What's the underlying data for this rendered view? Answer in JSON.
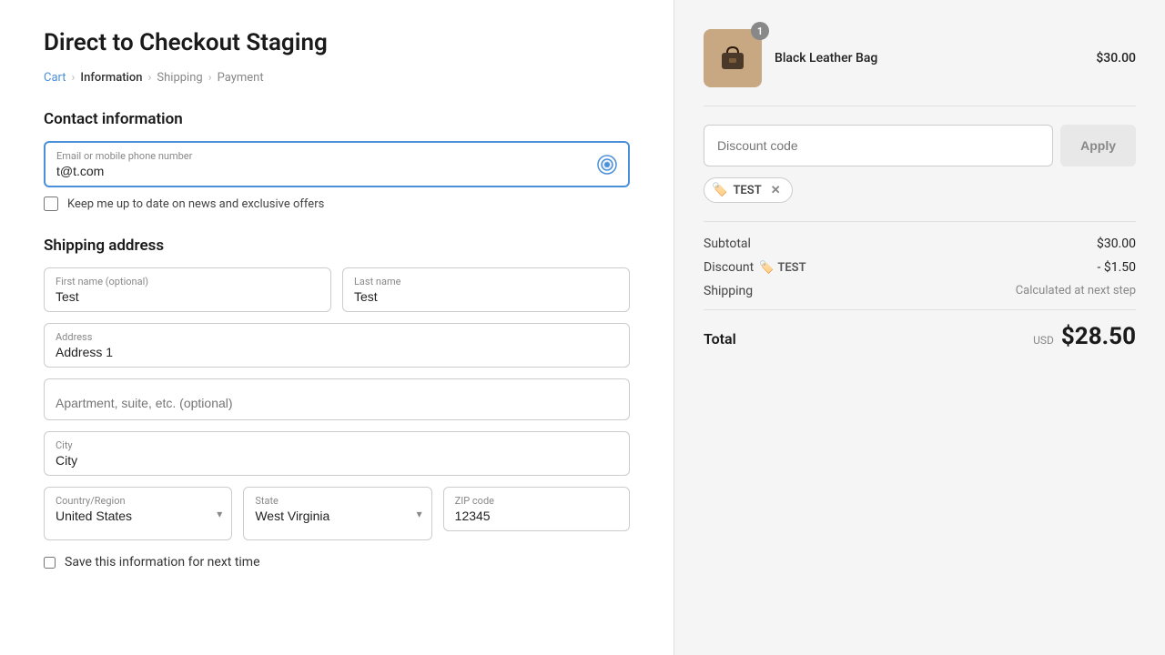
{
  "page": {
    "title": "Direct to Checkout Staging"
  },
  "breadcrumb": {
    "items": [
      "Cart",
      "Information",
      "Shipping",
      "Payment"
    ],
    "active": "Information"
  },
  "contact": {
    "section_title": "Contact information",
    "email_label": "Email or mobile phone number",
    "email_value": "t@t.com",
    "email_placeholder": "",
    "newsletter_label": "Keep me up to date on news and exclusive offers"
  },
  "shipping": {
    "section_title": "Shipping address",
    "first_name_label": "First name (optional)",
    "first_name_value": "Test",
    "last_name_label": "Last name",
    "last_name_value": "Test",
    "address_label": "Address",
    "address_value": "Address 1",
    "apt_label": "Apartment, suite, etc. (optional)",
    "apt_value": "",
    "city_label": "City",
    "city_value": "City",
    "country_label": "Country/Region",
    "country_value": "United States",
    "state_label": "State",
    "state_value": "West Virginia",
    "zip_label": "ZIP code",
    "zip_value": "12345",
    "save_label": "Save this information for next time"
  },
  "order": {
    "product_name": "Black Leather Bag",
    "product_price": "$30.00",
    "product_quantity": "1",
    "discount_placeholder": "Discount code",
    "apply_label": "Apply",
    "discount_tag": "TEST",
    "subtotal_label": "Subtotal",
    "subtotal_value": "$30.00",
    "discount_label": "Discount",
    "discount_code": "TEST",
    "discount_value": "- $1.50",
    "shipping_label": "Shipping",
    "shipping_value": "Calculated at next step",
    "total_label": "Total",
    "total_currency": "USD",
    "total_amount": "$28.50"
  }
}
